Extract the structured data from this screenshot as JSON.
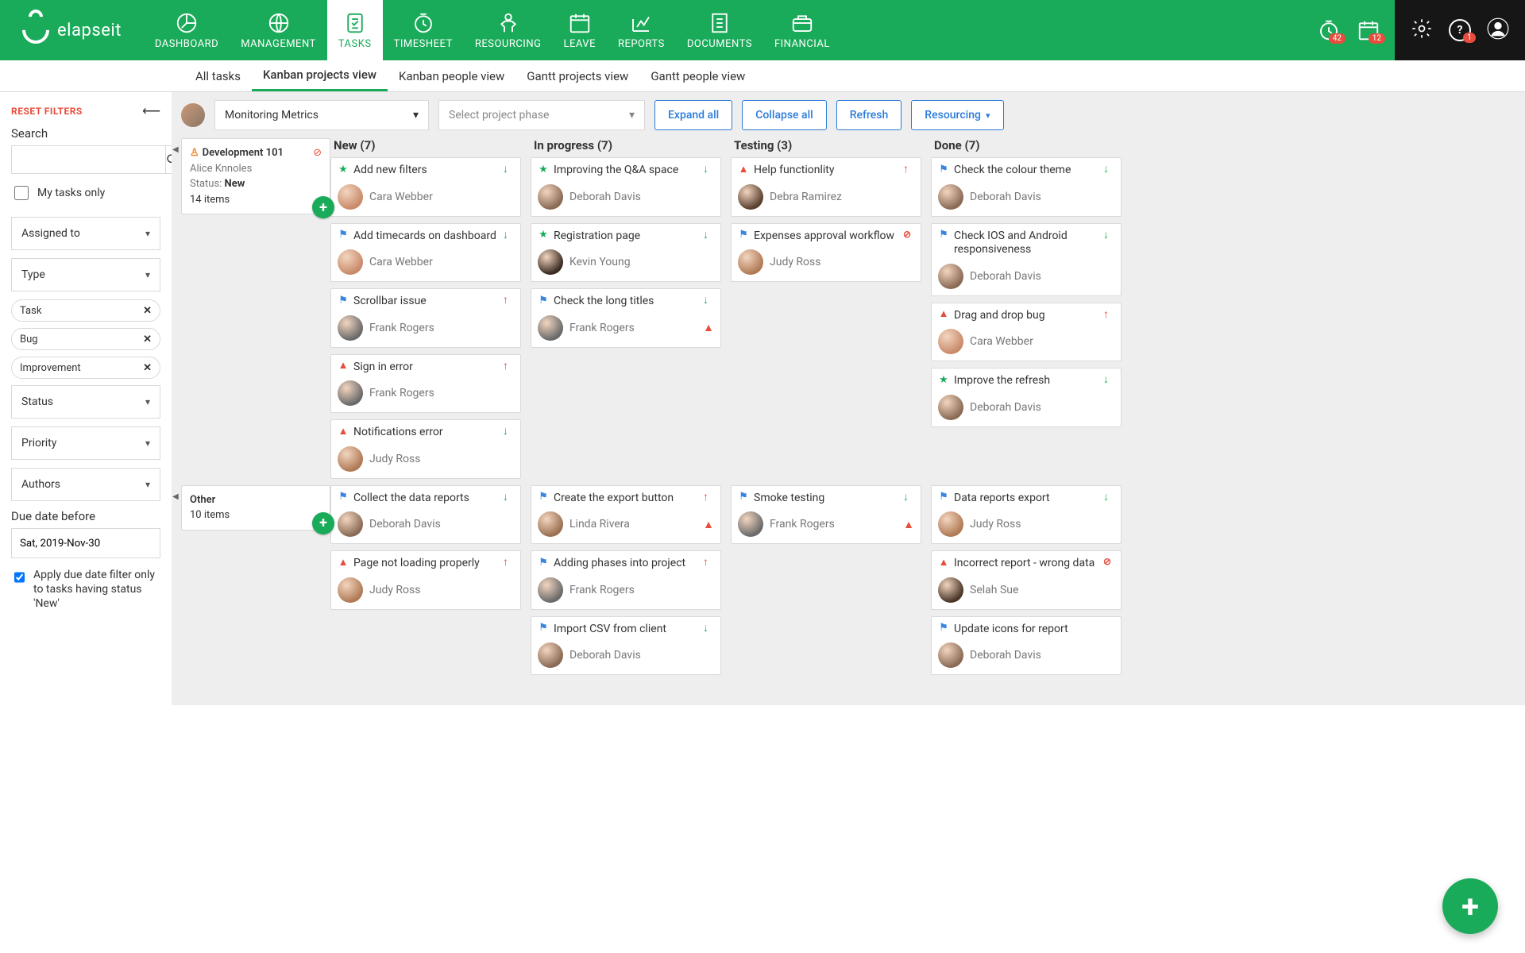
{
  "brand": "elapseit",
  "nav": [
    {
      "label": "DASHBOARD"
    },
    {
      "label": "MANAGEMENT"
    },
    {
      "label": "TASKS"
    },
    {
      "label": "TIMESHEET"
    },
    {
      "label": "RESOURCING"
    },
    {
      "label": "LEAVE"
    },
    {
      "label": "REPORTS"
    },
    {
      "label": "DOCUMENTS"
    },
    {
      "label": "FINANCIAL"
    }
  ],
  "nav_active": 2,
  "badges": {
    "clock": "42",
    "calendar": "12",
    "help": "1"
  },
  "subnav": [
    {
      "label": "All tasks"
    },
    {
      "label": "Kanban projects view"
    },
    {
      "label": "Kanban people view"
    },
    {
      "label": "Gantt projects view"
    },
    {
      "label": "Gantt people view"
    }
  ],
  "subnav_active": 1,
  "sidebar": {
    "reset": "RESET FILTERS",
    "search_label": "Search",
    "my_tasks": "My tasks only",
    "assigned": "Assigned to",
    "type": "Type",
    "chips": [
      "Task",
      "Bug",
      "Improvement"
    ],
    "status": "Status",
    "priority": "Priority",
    "authors": "Authors",
    "due_label": "Due date before",
    "due_value": "Sat, 2019-Nov-30",
    "apply_due": "Apply due date filter only to tasks having status 'New'"
  },
  "toolbar": {
    "project": "Monitoring Metrics",
    "phase_placeholder": "Select project phase",
    "expand": "Expand all",
    "collapse": "Collapse all",
    "refresh": "Refresh",
    "resourcing": "Resourcing"
  },
  "columns": [
    {
      "label": "New (7)"
    },
    {
      "label": "In progress (7)"
    },
    {
      "label": "Testing (3)"
    },
    {
      "label": "Done (7)"
    }
  ],
  "groups": [
    {
      "name": "Development 101",
      "owner": "Alice Knnoles",
      "status_label": "Status:",
      "status": "New",
      "items": "14 items",
      "has_icon": true,
      "has_err": true,
      "cols": [
        [
          {
            "t": "imp",
            "title": "Add new filters",
            "p": "down",
            "a": "Cara Webber"
          },
          {
            "t": "task",
            "title": "Add timecards on dashboard",
            "p": "down",
            "a": "Cara Webber"
          },
          {
            "t": "task",
            "title": "Scrollbar issue",
            "p": "up",
            "a": "Frank Rogers"
          },
          {
            "t": "bug",
            "title": "Sign in error",
            "p": "up",
            "a": "Frank Rogers"
          },
          {
            "t": "bug",
            "title": "Notifications error",
            "p": "down",
            "a": "Judy Ross"
          }
        ],
        [
          {
            "t": "imp",
            "title": "Improving the Q&A space",
            "p": "down",
            "a": "Deborah Davis"
          },
          {
            "t": "imp",
            "title": "Registration page",
            "p": "down",
            "a": "Kevin Young"
          },
          {
            "t": "task",
            "title": "Check the long titles",
            "p": "down",
            "a": "Frank Rogers",
            "warn": true
          }
        ],
        [
          {
            "t": "bug",
            "title": "Help functionlity",
            "p": "up",
            "a": "Debra Ramirez"
          },
          {
            "t": "task",
            "title": "Expenses approval workflow",
            "p": "circ",
            "a": "Judy Ross"
          }
        ],
        [
          {
            "t": "task",
            "title": "Check the colour theme",
            "p": "down",
            "a": "Deborah Davis"
          },
          {
            "t": "task",
            "title": "Check IOS and Android responsiveness",
            "p": "down",
            "a": "Deborah Davis"
          },
          {
            "t": "bug",
            "title": "Drag and drop bug",
            "p": "up",
            "a": "Cara Webber"
          },
          {
            "t": "imp",
            "title": "Improve the refresh",
            "p": "down",
            "a": "Deborah Davis"
          }
        ]
      ]
    },
    {
      "name": "Other",
      "items": "10 items",
      "cols": [
        [
          {
            "t": "task",
            "title": "Collect the data reports",
            "p": "down",
            "a": "Deborah Davis"
          },
          {
            "t": "bug",
            "title": "Page not loading properly",
            "p": "up",
            "a": "Judy Ross"
          }
        ],
        [
          {
            "t": "task",
            "title": "Create the export button",
            "p": "up",
            "a": "Linda Rivera",
            "warn": true
          },
          {
            "t": "task",
            "title": "Adding phases into project",
            "p": "up",
            "a": "Frank Rogers"
          },
          {
            "t": "task",
            "title": "Import CSV from client",
            "p": "down",
            "a": "Deborah Davis"
          }
        ],
        [
          {
            "t": "task",
            "title": "Smoke testing",
            "p": "down",
            "a": "Frank Rogers",
            "warn": true
          }
        ],
        [
          {
            "t": "task",
            "title": "Data reports export",
            "p": "down",
            "a": "Judy Ross"
          },
          {
            "t": "bug",
            "title": "Incorrect report - wrong data",
            "p": "circ",
            "a": "Selah Sue"
          },
          {
            "t": "task",
            "title": "Update icons for report",
            "p": "",
            "a": "Deborah Davis"
          }
        ]
      ]
    }
  ]
}
